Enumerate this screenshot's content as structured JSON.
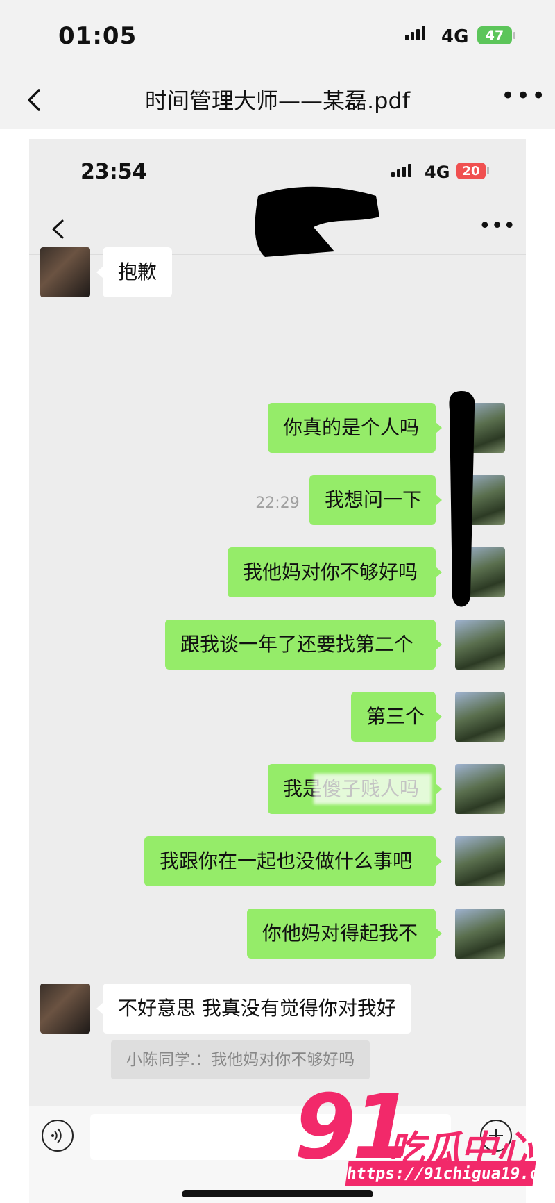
{
  "outer": {
    "status": {
      "time": "01:05",
      "network": "4G",
      "battery": "47"
    },
    "nav": {
      "title": "时间管理大师——某磊.pdf",
      "back_icon": "chevron-left-icon",
      "more_icon": "more-dots-icon"
    }
  },
  "inner": {
    "status": {
      "time": "23:54",
      "network": "4G",
      "battery": "20"
    },
    "chat": {
      "first_message": "抱歉",
      "timestamp": "22:29",
      "sent_messages": [
        "你真的是个人吗",
        "我想问一下",
        "我他妈对你不够好吗",
        "跟我谈一年了还要找第二个",
        "第三个",
        "我是傻子贱人吗",
        "我跟你在一起也没做什么事吧",
        "你他妈对得起我不"
      ],
      "reply": "不好意思 我真没有觉得你对我好",
      "quote": "小陈同学.：我他妈对你不够好吗"
    }
  },
  "watermark": {
    "number": "91",
    "text": "吃瓜中心",
    "url": "https://91chigua19.com"
  },
  "colors": {
    "sent_bubble": "#95ec69",
    "received_bubble": "#ffffff",
    "watermark": "#f2296a"
  }
}
